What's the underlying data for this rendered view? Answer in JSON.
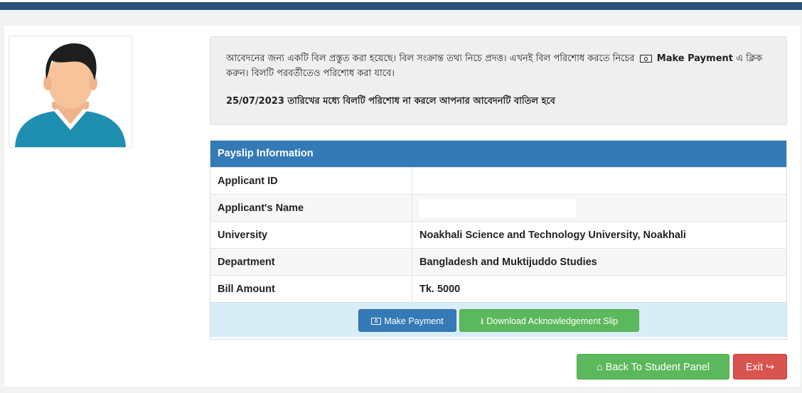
{
  "notice": {
    "line1_pre": "আবেদনের জন্য একটি বিল প্রস্তুত করা হয়েছে। বিল সংক্রান্ত তথ্য নিচে প্রদত্ত। এখনই বিল পরিশোধ করতে নিচের",
    "line1_bold": "Make Payment",
    "line1_post": "এ ক্লিক করুন। বিলটি পরবর্তীতেও পরিশোধ করা যাবে।",
    "line2": "25/07/2023 তারিখের মধ্যে বিলটি পরিশোধ না করলে আপনার আবেদনটি বাতিল হবে"
  },
  "payslip": {
    "title": "Payslip Information",
    "rows": [
      {
        "label": "Applicant ID",
        "value": ""
      },
      {
        "label": "Applicant's Name",
        "value": ""
      },
      {
        "label": "University",
        "value": "Noakhali Science and Technology University, Noakhali"
      },
      {
        "label": "Department",
        "value": "Bangladesh and Muktijuddo Studies"
      },
      {
        "label": "Bill Amount",
        "value": "Tk. 5000"
      }
    ]
  },
  "buttons": {
    "make_payment": "Make Payment",
    "download_slip": "Download Acknowledgement Slip",
    "back_to_panel": "Back To Student Panel",
    "exit": "Exit"
  },
  "icons": {
    "make_payment": "money-icon",
    "download_slip": "download-icon",
    "back_to_panel": "home-icon",
    "exit": "sign-out-icon"
  },
  "colors": {
    "primary": "#337ab7",
    "success": "#5cb85c",
    "danger": "#d9534f",
    "topbar": "#2b5278",
    "actions_bg": "#d9edf7"
  }
}
